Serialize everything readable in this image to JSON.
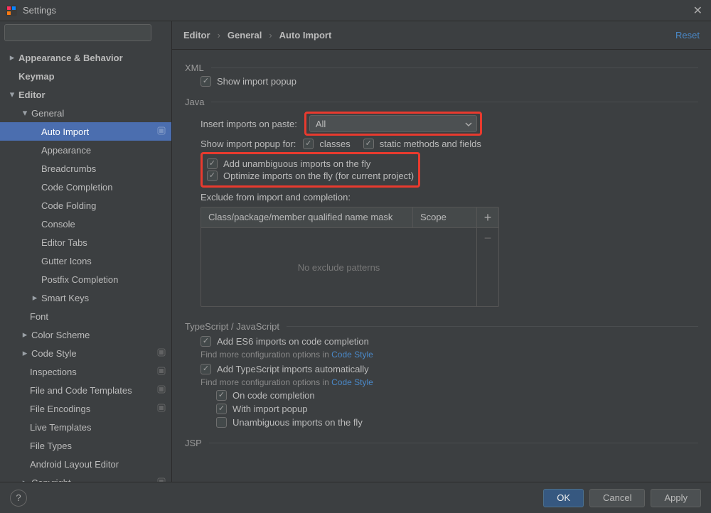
{
  "window": {
    "title": "Settings"
  },
  "search": {
    "placeholder": ""
  },
  "nav": {
    "appearance": "Appearance & Behavior",
    "keymap": "Keymap",
    "editor": "Editor",
    "general": "General",
    "auto_import": "Auto Import",
    "appearance2": "Appearance",
    "breadcrumbs": "Breadcrumbs",
    "code_completion": "Code Completion",
    "code_folding": "Code Folding",
    "console": "Console",
    "editor_tabs": "Editor Tabs",
    "gutter_icons": "Gutter Icons",
    "postfix": "Postfix Completion",
    "smart_keys": "Smart Keys",
    "font": "Font",
    "color_scheme": "Color Scheme",
    "code_style": "Code Style",
    "inspections": "Inspections",
    "file_templates": "File and Code Templates",
    "file_encodings": "File Encodings",
    "live_templates": "Live Templates",
    "file_types": "File Types",
    "android_layout": "Android Layout Editor",
    "copyright": "Copyright"
  },
  "breadcrumb": {
    "a": "Editor",
    "b": "General",
    "c": "Auto Import",
    "reset": "Reset"
  },
  "sections": {
    "xml": "XML",
    "java": "Java",
    "ts": "TypeScript / JavaScript",
    "jsp": "JSP"
  },
  "xml": {
    "show_popup": "Show import popup"
  },
  "java": {
    "insert_label": "Insert imports on paste:",
    "insert_value": "All",
    "popup_label": "Show import popup for:",
    "opt_classes": "classes",
    "opt_static": "static methods and fields",
    "add_unambig": "Add unambiguous imports on the fly",
    "optimize": "Optimize imports on the fly (for current project)",
    "exclude_label": "Exclude from import and completion:",
    "col_mask": "Class/package/member qualified name mask",
    "col_scope": "Scope",
    "empty": "No exclude patterns"
  },
  "ts": {
    "add_es6": "Add ES6 imports on code completion",
    "hint1a": "Find more configuration options in ",
    "hint1b": "Code Style",
    "add_ts": "Add TypeScript imports automatically",
    "on_comp": "On code completion",
    "with_popup": "With import popup",
    "unambig": "Unambiguous imports on the fly"
  },
  "footer": {
    "ok": "OK",
    "cancel": "Cancel",
    "apply": "Apply"
  }
}
